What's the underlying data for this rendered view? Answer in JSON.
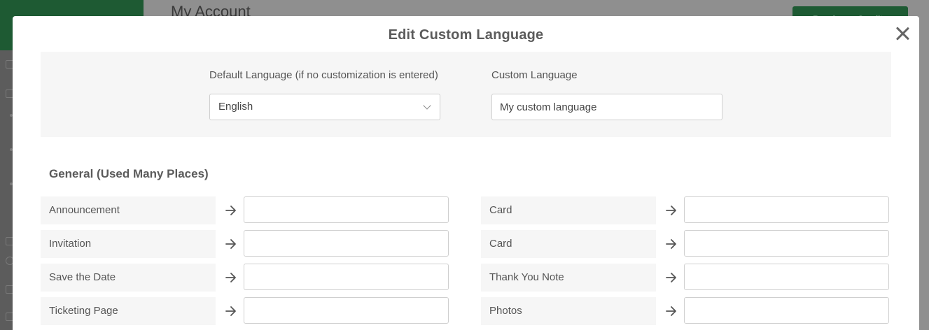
{
  "background": {
    "page_title": "My Account",
    "primary_button": "Purchase Credits"
  },
  "modal": {
    "title": "Edit Custom Language",
    "default_language": {
      "label": "Default Language (if no customization is entered)",
      "value": "English"
    },
    "custom_language": {
      "label": "Custom Language",
      "value": "My custom language"
    },
    "section_title": "General (Used Many Places)",
    "left_rows": [
      {
        "label": "Announcement",
        "value": ""
      },
      {
        "label": "Invitation",
        "value": ""
      },
      {
        "label": "Save the Date",
        "value": ""
      },
      {
        "label": "Ticketing Page",
        "value": ""
      }
    ],
    "right_rows": [
      {
        "label": "Card",
        "value": ""
      },
      {
        "label": "Card",
        "value": ""
      },
      {
        "label": "Thank You Note",
        "value": ""
      },
      {
        "label": "Photos",
        "value": ""
      }
    ]
  },
  "colors": {
    "brand_green": "#1e5a33",
    "overlay_gray": "#8f8f8f",
    "panel_bg": "#f6f6f6"
  }
}
